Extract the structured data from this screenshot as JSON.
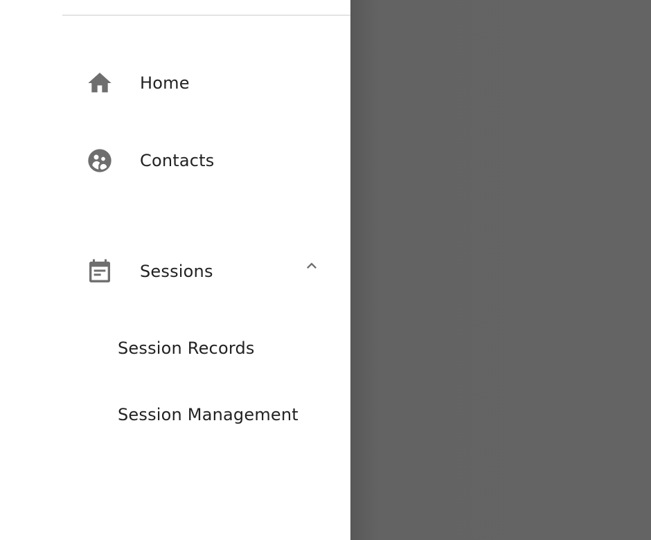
{
  "drawer": {
    "items": [
      {
        "label": "Home",
        "icon": "home-icon"
      },
      {
        "label": "Contacts",
        "icon": "contacts-icon"
      },
      {
        "label": "Sessions",
        "icon": "calendar-icon",
        "expanded": true
      }
    ],
    "sessions_submenu": [
      {
        "label": "Session Records"
      },
      {
        "label": "Session Management"
      }
    ]
  },
  "colors": {
    "icon": "#6e6e6e",
    "text": "#222222",
    "scrim": "#646464",
    "divider": "#e4e4e4"
  }
}
